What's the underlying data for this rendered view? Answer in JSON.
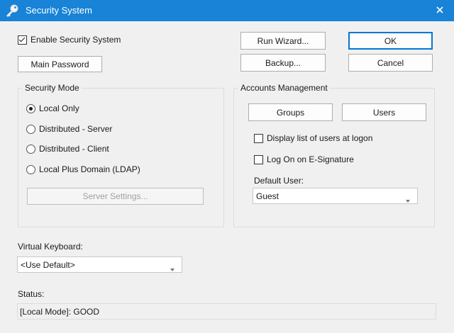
{
  "window": {
    "title": "Security System",
    "titlebar_color": "#1883d7",
    "icon": "key-icon",
    "close_icon": "close-icon"
  },
  "enable_security": {
    "label": "Enable Security System",
    "checked": true
  },
  "buttons": {
    "main_password": "Main Password",
    "run_wizard": "Run Wizard...",
    "ok": "OK",
    "backup": "Backup...",
    "cancel": "Cancel",
    "server_settings": "Server Settings...",
    "groups": "Groups",
    "users": "Users"
  },
  "security_mode": {
    "title": "Security Mode",
    "options": [
      {
        "label": "Local Only",
        "checked": true
      },
      {
        "label": "Distributed - Server",
        "checked": false
      },
      {
        "label": "Distributed - Client",
        "checked": false
      },
      {
        "label": "Local Plus Domain (LDAP)",
        "checked": false
      }
    ]
  },
  "accounts": {
    "title": "Accounts Management",
    "display_list": {
      "label": "Display list of users at logon",
      "checked": false
    },
    "esignature": {
      "label": "Log On on E-Signature",
      "checked": false
    },
    "default_user_label": "Default User:",
    "default_user_value": "Guest"
  },
  "virtual_keyboard": {
    "label": "Virtual Keyboard:",
    "value": "<Use Default>"
  },
  "status": {
    "label": "Status:",
    "value": "[Local Mode]: GOOD"
  },
  "colors": {
    "accent": "#0078d7",
    "background": "#f0f0f0"
  }
}
